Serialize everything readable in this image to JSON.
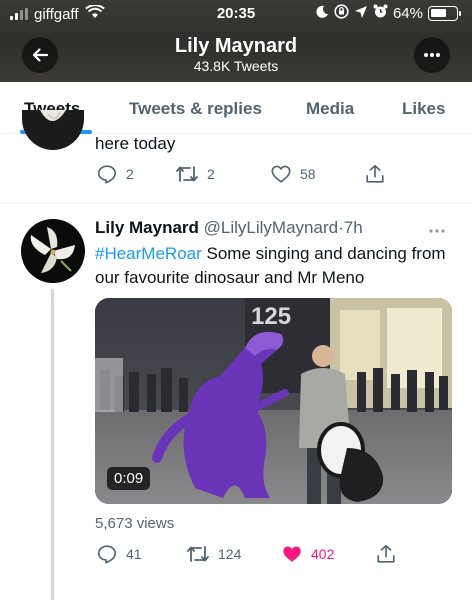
{
  "status_bar": {
    "carrier": "giffgaff",
    "time": "20:35",
    "battery": "64%",
    "battery_level": 0.64,
    "icons": [
      "signal-icon",
      "wifi-icon",
      "moon-icon",
      "screen-lock-icon",
      "location-icon",
      "alarm-icon",
      "battery-icon"
    ]
  },
  "header": {
    "name": "Lily Maynard",
    "tweet_count": "43.8K Tweets",
    "back_icon": "back-arrow-icon",
    "more_icon": "more-icon"
  },
  "tabs": [
    {
      "label": "Tweets",
      "active": true
    },
    {
      "label": "Tweets & replies",
      "active": false
    },
    {
      "label": "Media",
      "active": false
    },
    {
      "label": "Likes",
      "active": false
    }
  ],
  "previous_tweet": {
    "text_fragment": "here today",
    "reply_count": "2",
    "retweet_count": "2",
    "like_count": "58"
  },
  "tweet": {
    "name": "Lily Maynard",
    "handle": "@LilyLilyMaynard",
    "separator": "·",
    "time": "7h",
    "hashtag": "#HearMeRoar",
    "text": " Some singing and dancing from our favourite dinosaur and Mr Meno",
    "media": {
      "type": "video",
      "duration": "0:09",
      "sign_text": "125"
    },
    "views": "5,673 views",
    "reply_count": "41",
    "retweet_count": "124",
    "like_count": "402",
    "liked": true
  },
  "colors": {
    "accent": "#1d9bf0",
    "like": "#f91880",
    "secondary_text": "#536471",
    "header_bg": "#32322f"
  }
}
